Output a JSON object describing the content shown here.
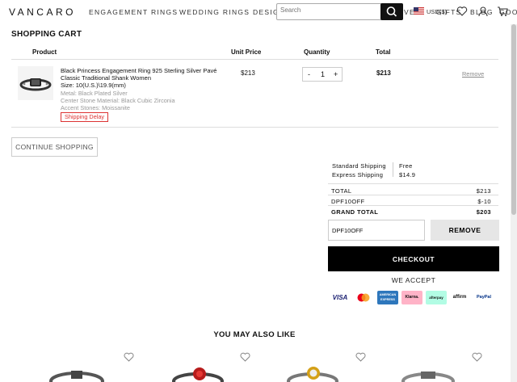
{
  "header": {
    "logo": "VANCARO",
    "nav": [
      "ENGAGEMENT RINGS",
      "WEDDING RINGS",
      "DESIG",
      "VEL",
      "GIFTS",
      "BLOG",
      "GOO"
    ],
    "search": {
      "placeholder": "Search"
    },
    "currency": "USD($)"
  },
  "cart": {
    "title": "SHOPPING CART",
    "columns": {
      "product": "Product",
      "unit_price": "Unit Price",
      "quantity": "Quantity",
      "total": "Total"
    },
    "item": {
      "name": "Black Princess Engagement Ring 925 Sterling Silver Pavé Classic Traditional Shank Women",
      "size": "Size: 10(U.S.)\\19.9(mm)",
      "metal": "Metal: Black Plated Silver",
      "center_stone": "Center Stone Material: Black Cubic Zirconia",
      "accent_stones": "Accent Stones: Moissanite",
      "badge": "Shipping Delay",
      "unit_price": "$213",
      "quantity": "1",
      "minus": "-",
      "plus": "+",
      "total": "$213",
      "remove": "Remove"
    },
    "continue_label": "CONTINUE SHOPPING"
  },
  "summary": {
    "shipping": [
      {
        "label": "Standard Shipping",
        "value": "Free"
      },
      {
        "label": "Express Shipping",
        "value": "$14.9"
      }
    ],
    "rows": [
      {
        "label": "TOTAL",
        "value": "$213"
      },
      {
        "label": "DPF10OFF",
        "value": "$-10"
      },
      {
        "label": "GRAND TOTAL",
        "value": "$203"
      }
    ],
    "coupon_value": "DPF10OFF",
    "remove_label": "REMOVE",
    "checkout_label": "CHECKOUT",
    "we_accept": "WE ACCEPT",
    "payments": [
      "VISA",
      "",
      "AMERICAN EXPRESS",
      "Klarna.",
      "afterpay",
      "affirm",
      "PayPal"
    ]
  },
  "recommend": {
    "title": "YOU MAY ALSO LIKE"
  },
  "colors": {
    "accent": "#000000",
    "badge": "#dd3333",
    "muted": "#999999"
  }
}
